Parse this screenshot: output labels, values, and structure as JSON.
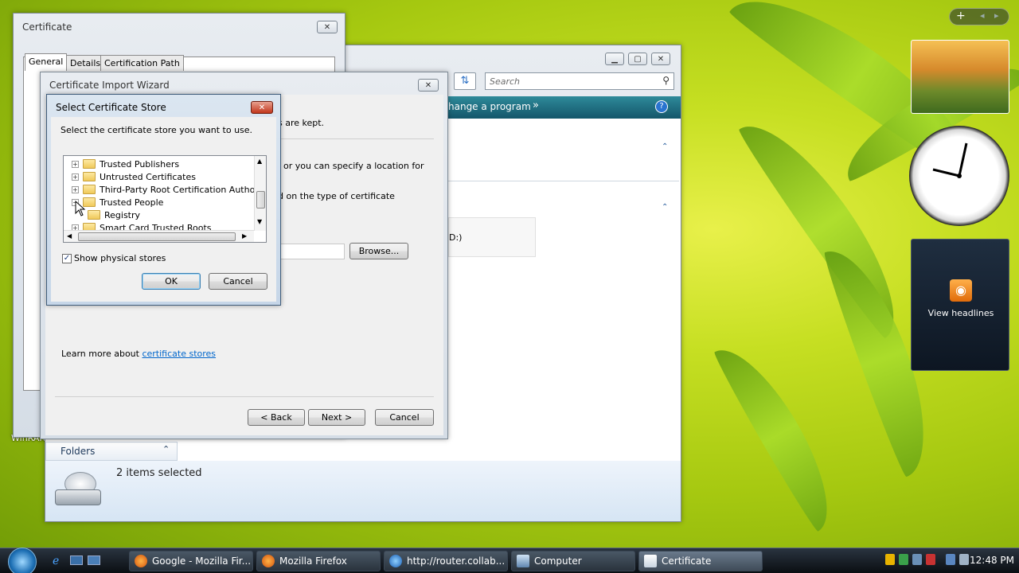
{
  "certificate_window": {
    "title": "Certificate",
    "tabs": [
      "General",
      "Details",
      "Certification Path"
    ]
  },
  "explorer": {
    "search_placeholder": "Search",
    "toolbar_item": "hange a program",
    "chevron": "»",
    "drive_label": "D:)",
    "folders_label": "Folders",
    "details_text": "2 items selected"
  },
  "import_wizard": {
    "title": "Certificate Import Wizard",
    "text1": "s are kept.",
    "text2": "or you can specify a location for",
    "text3": "d on the type of certificate",
    "browse_label": "Browse...",
    "learn_more_prefix": "Learn more about ",
    "learn_more_link": "certificate stores",
    "back_label": "< Back",
    "next_label": "Next >",
    "cancel_label": "Cancel"
  },
  "select_store": {
    "title": "Select Certificate Store",
    "instruction": "Select the certificate store you want to use.",
    "tree": [
      {
        "label": "Trusted Publishers",
        "expander": "+"
      },
      {
        "label": "Untrusted Certificates",
        "expander": "+"
      },
      {
        "label": "Third-Party Root Certification Authorities",
        "expander": "+"
      },
      {
        "label": "Trusted People",
        "expander": "−"
      },
      {
        "label": "Registry",
        "expander": ""
      },
      {
        "label": "Smart Card Trusted Roots",
        "expander": "+"
      }
    ],
    "show_physical_label": "Show physical stores",
    "show_physical_checked": true,
    "ok_label": "OK",
    "cancel_label": "Cancel"
  },
  "desktop_icons": {
    "winrar": "WinRAR"
  },
  "sidebar": {
    "add": "+",
    "feeds_label": "View headlines"
  },
  "taskbar": {
    "items": [
      {
        "label": "Google - Mozilla Fir..."
      },
      {
        "label": "Mozilla Firefox"
      },
      {
        "label": "http://router.collab..."
      },
      {
        "label": "Computer"
      },
      {
        "label": "Certificate"
      }
    ],
    "clock": "12:48 PM"
  }
}
